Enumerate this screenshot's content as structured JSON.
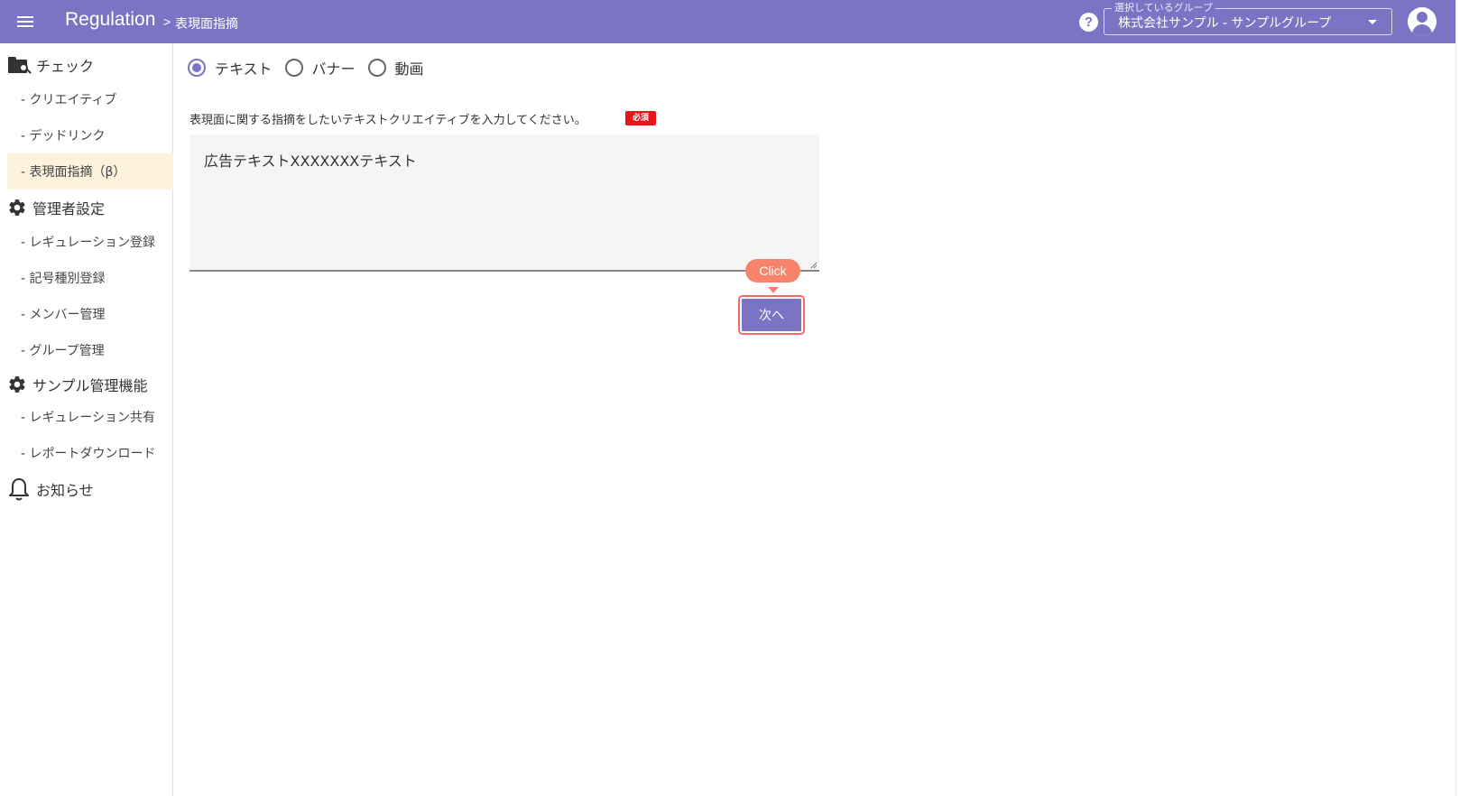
{
  "header": {
    "app_title": "Regulation",
    "breadcrumb_sep": ">",
    "breadcrumb_page": "表現面指摘",
    "help_icon": "?",
    "group_select": {
      "legend": "選択しているグループ",
      "value": "株式会社サンプル - サンプルグループ"
    }
  },
  "sidebar": {
    "sections": [
      {
        "label": "チェック",
        "icon": "folder-search-icon",
        "items": [
          {
            "label": "- クリエイティブ",
            "active": false
          },
          {
            "label": "- デッドリンク",
            "active": false
          },
          {
            "label": "- 表現面指摘（β）",
            "active": true
          }
        ]
      },
      {
        "label": "管理者設定",
        "icon": "gear-icon",
        "items": [
          {
            "label": "- レギュレーション登録",
            "active": false
          },
          {
            "label": "- 記号種別登録",
            "active": false
          },
          {
            "label": "- メンバー管理",
            "active": false
          },
          {
            "label": "- グループ管理",
            "active": false
          }
        ]
      },
      {
        "label": "サンプル管理機能",
        "icon": "gear-icon",
        "items": [
          {
            "label": "- レギュレーション共有",
            "active": false
          },
          {
            "label": "- レポートダウンロード",
            "active": false
          }
        ]
      },
      {
        "label": "お知らせ",
        "icon": "bell-icon",
        "items": []
      }
    ]
  },
  "main": {
    "media_type_options": [
      {
        "label": "テキスト",
        "checked": true
      },
      {
        "label": "バナー",
        "checked": false
      },
      {
        "label": "動画",
        "checked": false
      }
    ],
    "field_label": "表現面に関する指摘をしたいテキストクリエイティブを入力してください。",
    "required_badge": "必須",
    "textarea_value": "広告テキストXXXXXXXテキスト",
    "next_button": "次へ",
    "click_hint": "Click"
  },
  "colors": {
    "primary": "#7b74c4",
    "active_bg": "#fdf3dc",
    "required": "#e8151b",
    "hint": "#f8836b"
  }
}
